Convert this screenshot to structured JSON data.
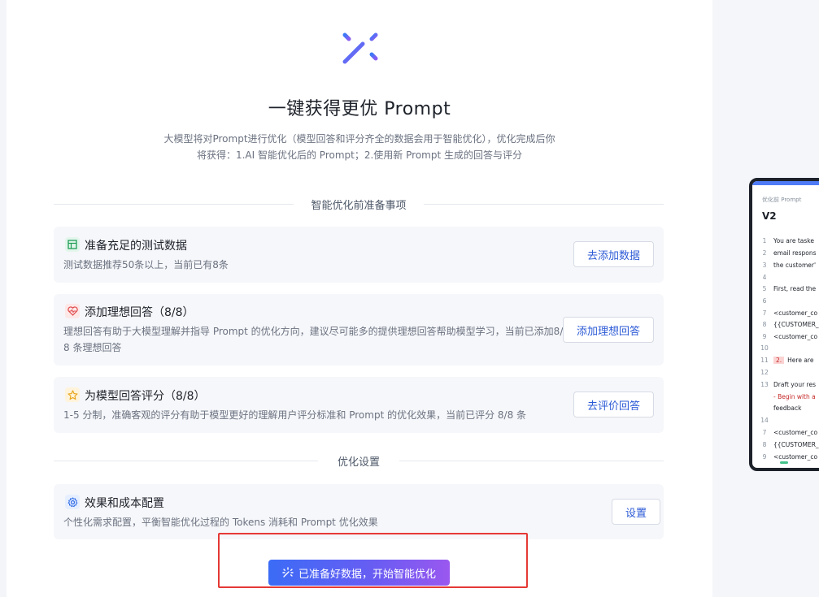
{
  "hero": {
    "title": "一键获得更优 Prompt",
    "desc_line1": "大模型将对Prompt进行优化（模型回答和评分齐全的数据会用于智能优化），优化完成后你",
    "desc_line2": "将获得：1.AI 智能优化后的 Prompt；2.使用新 Prompt 生成的回答与评分"
  },
  "section_prep": "智能优化前准备事项",
  "section_settings": "优化设置",
  "cards": [
    {
      "icon": "table-icon",
      "title": "准备充足的测试数据",
      "desc": "测试数据推荐50条以上，当前已有8条",
      "button": "去添加数据"
    },
    {
      "icon": "heart-pulse-icon",
      "title": "添加理想回答（8/8）",
      "desc_line1": "理想回答有助于大模型理解并指导 Prompt 的优化方向，建议尽可能多的提供理想回答帮助模型学习，当前已添加8/",
      "desc_line2": "8 条理想回答",
      "button": "添加理想回答"
    },
    {
      "icon": "star-icon",
      "title": "为模型回答评分（8/8）",
      "desc": "1-5 分制，准确客观的评分有助于模型更好的理解用户评分标准和 Prompt 的优化效果，当前已评分 8/8 条",
      "button": "去评价回答"
    },
    {
      "icon": "gear-icon",
      "title": "效果和成本配置",
      "desc": "个性化需求配置，平衡智能优化过程的 Tokens 消耗和 Prompt 优化效果",
      "button": "设置"
    }
  ],
  "start_button": "已准备好数据，开始智能优化",
  "preview": {
    "label": "优化前 Prompt",
    "version": "V2",
    "lines": [
      {
        "n": "1",
        "t": "You are taske"
      },
      {
        "n": "2",
        "t": "email respons"
      },
      {
        "n": "3",
        "t": "the customer'"
      },
      {
        "n": "4",
        "t": ""
      },
      {
        "n": "5",
        "t": "First, read the"
      },
      {
        "n": "6",
        "t": ""
      },
      {
        "n": "7",
        "t": "<customer_co"
      },
      {
        "n": "8",
        "t": "{{CUSTOMER_"
      },
      {
        "n": "9",
        "t": "<customer_co"
      },
      {
        "n": "10",
        "t": ""
      },
      {
        "n": "11",
        "badge": "2.",
        "t": "Here are"
      },
      {
        "n": "12",
        "t": ""
      },
      {
        "n": "13",
        "t": "Draft your res"
      },
      {
        "n": "",
        "t": "- Begin with a",
        "red": true
      },
      {
        "n": "",
        "t": "feedback"
      },
      {
        "n": "14",
        "t": ""
      },
      {
        "n": "7",
        "t": "<customer_co"
      },
      {
        "n": "8",
        "t": "{{CUSTOMER_"
      },
      {
        "n": "9",
        "t": "<customer_co"
      }
    ]
  },
  "colors": {
    "accent": "#2d5bd6",
    "gradient_start": "#3b6cf6",
    "gradient_end": "#9a58ef",
    "highlight": "#e53935"
  }
}
